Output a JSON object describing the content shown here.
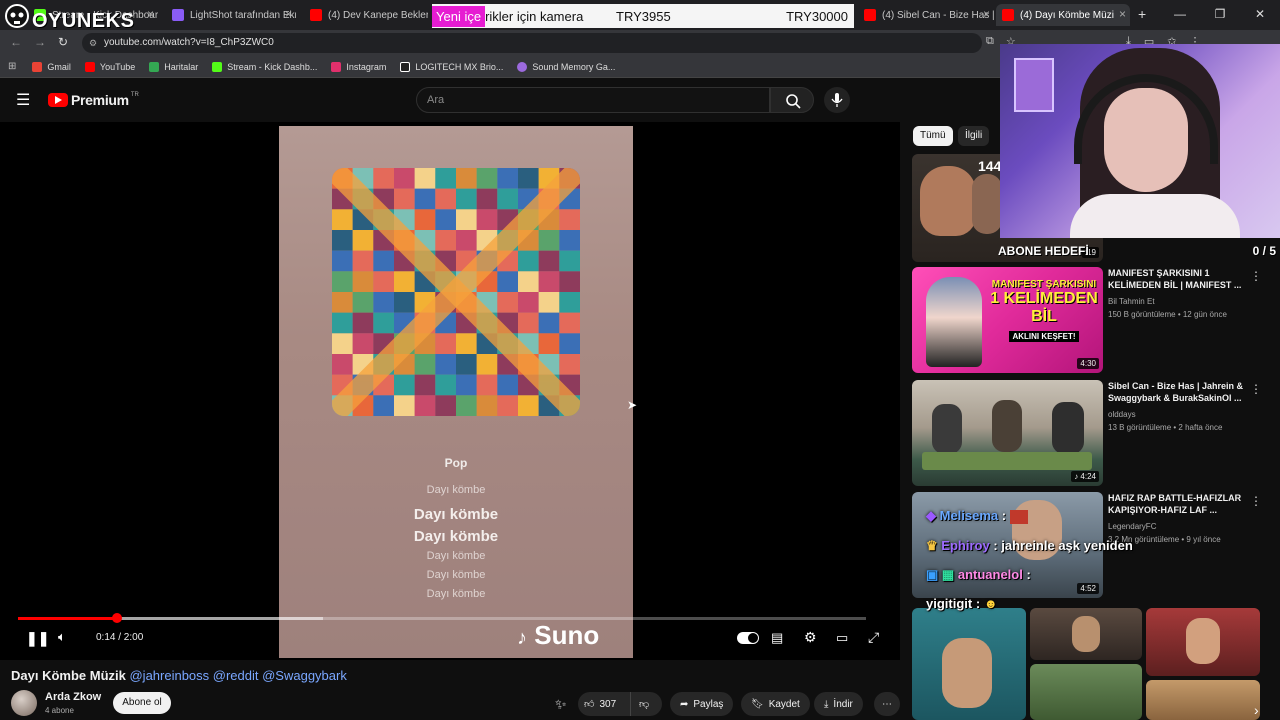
{
  "overlay": {
    "brand": "OYUNEKS",
    "promo_highlight": "Yeni içe",
    "promo_text": "rikler için kamera",
    "promo_amount_1": "TRY3955",
    "promo_amount_2": "TRY30000",
    "goal_label": "ABONE HEDEFİ",
    "goal_count": "0 / 5",
    "chat": [
      {
        "user": "Melisema",
        "msg": ""
      },
      {
        "user": "Ephiroy",
        "msg": ": jahreinle aşk yeniden"
      },
      {
        "user": "antuanelol",
        "msg": ":"
      },
      {
        "user": "yigitigit",
        "msg": ":"
      }
    ]
  },
  "browser": {
    "tabs": [
      {
        "label": "Stream - Kick Dashboard",
        "color": "#53fc18"
      },
      {
        "label": "LightShot tarafından Ekra",
        "color": "#8a5cf6"
      },
      {
        "label": "(4) Dev Kanepe Beklerken",
        "color": "#ff0000"
      },
      {
        "label": "(4) Sibel Can - Bize Has | J",
        "color": "#ff0000"
      },
      {
        "label": "(4) Dayı Kömbe Müzi",
        "color": "#ff0000"
      }
    ],
    "new_tab": "+",
    "url": "youtube.com/watch?v=I8_ChP3ZWC0",
    "bookmarks": [
      {
        "label": "Gmail",
        "color": "#ea4335"
      },
      {
        "label": "YouTube",
        "color": "#ff0000"
      },
      {
        "label": "Haritalar",
        "color": "#34a853"
      },
      {
        "label": "Stream - Kick Dashb...",
        "color": "#53fc18"
      },
      {
        "label": "Instagram",
        "color": "#e1306c"
      },
      {
        "label": "LOGITECH MX Brio...",
        "color": "#ffffff"
      },
      {
        "label": "Sound Memory Ga...",
        "color": "#9c6ade"
      }
    ]
  },
  "youtube": {
    "logo": "Premium",
    "region": "TR",
    "search_placeholder": "Ara",
    "player": {
      "genre": "Pop",
      "lyrics": [
        "Dayı kömbe",
        "Dayı kömbe",
        "Dayı kömbe",
        "Dayı kömbe",
        "Dayı kömbe",
        "Dayı kömbe"
      ],
      "watermark": "Suno",
      "time": "0:14 / 2:00",
      "progress": 0.1167,
      "buffer": 0.36
    },
    "title_main": "Dayı Kömbe Müzik",
    "title_tags": "@jahreinboss @reddit @Swaggybark",
    "channel": "Arda Zkow",
    "subscribers": "4 abone",
    "subscribe_label": "Abone ol",
    "likes": "307",
    "share_label": "Paylaş",
    "save_label": "Kaydet",
    "download_label": "İndir",
    "chips": [
      "Tümü",
      "İlgili"
    ],
    "recommendations": [
      {
        "title": "MANIFEST ŞARKISINI 1 KELİMEDEN BİL | MANIFEST ...",
        "channel": "Bil Tahmin Et",
        "meta": "150 B görüntüleme • 12 gün önce",
        "duration": "4:30"
      },
      {
        "title": "Sibel Can - Bize Has | Jahrein & Swaggybark & BurakSakinOl ...",
        "channel": "olddays",
        "meta": "13 B görüntüleme • 2 hafta önce",
        "duration": "4:24"
      },
      {
        "title": "HAFIZ RAP BATTLE-HAFIZLAR KAPIŞIYOR-HAFIZ LAF ...",
        "channel": "LegendaryFC",
        "meta": "3,2 Mn görüntüleme • 9 yıl önce",
        "duration": "4:52"
      }
    ],
    "first_thumb_overlay": "144",
    "first_thumb_duration": ":19",
    "thumb_text": [
      "MANIFEST ŞARKISINI",
      "1 KELİMEDEN",
      "BİL",
      "AKLINI KEŞFET!"
    ]
  }
}
